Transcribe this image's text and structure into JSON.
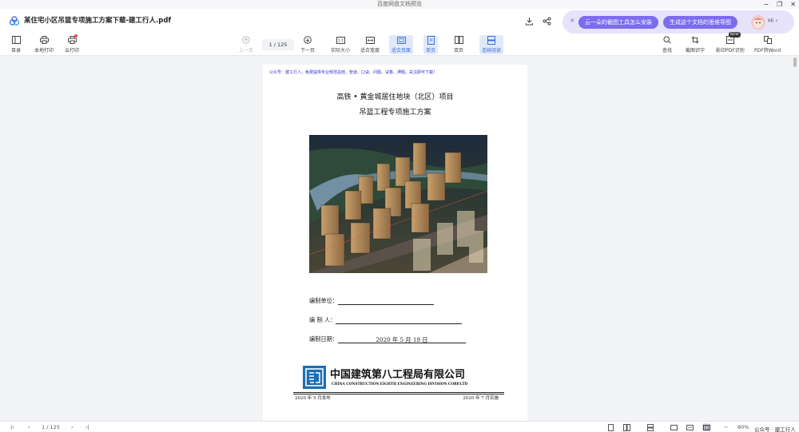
{
  "window": {
    "title": "百度网盘文档预览"
  },
  "document": {
    "file_name": "某住宅小区吊篮专项施工方案下载-建工行人.pdf"
  },
  "promo": {
    "close_glyph": "×",
    "pill_1": "云一朵的截图工具怎么安装",
    "pill_2": "生成这个文档的思维导图",
    "greeting": "Hi ›"
  },
  "toolbar": {
    "left": [
      "目录",
      "本地打印",
      "云打印"
    ],
    "prev": "上一页",
    "page_current": "1",
    "page_total": "125",
    "page_display": "1 / 125",
    "next": "下一页",
    "actual_size": "实际大小",
    "fit_width": "适合宽度",
    "fit_page": "适合页面",
    "single": "单页",
    "double": "双页",
    "continuous": "连续阅读",
    "right": [
      "查找",
      "截图识字",
      "影印PDF识别",
      "PDF转Word"
    ],
    "new_tag": "NEW"
  },
  "page": {
    "notice": "公众号：建工行人，免费提供专业规范总结、管道、口诀、问题、试卷、押题，关注即可下载！",
    "heading_1": "高铁 • 黄金城居住地块（北区）项目",
    "heading_2": "吊篮工程专项施工方案",
    "field_unit_label": "编制单位：",
    "field_person_label": "编  制  人：",
    "field_date_label": "编制日期：",
    "field_date_value": "2020 年 5 月 19 日",
    "company_cn": "中国建筑第八工程局有限公司",
    "company_en": "CHINA CONSTRUCTION EIGHTH ENGINEERING DIVISION CORP.LTD",
    "published": "2020 年 5 月发布",
    "implemented": "2020 年 7 月实施"
  },
  "statusbar": {
    "page_display": "1 / 125",
    "zoom": "80%"
  },
  "watermark": "公众号 · 建工行人",
  "colors": {
    "accent": "#3b6fd8",
    "promo_pill": "#7b6cf0",
    "logo_blue": "#1a6fb8",
    "notice_blue": "#2c2ccc"
  }
}
